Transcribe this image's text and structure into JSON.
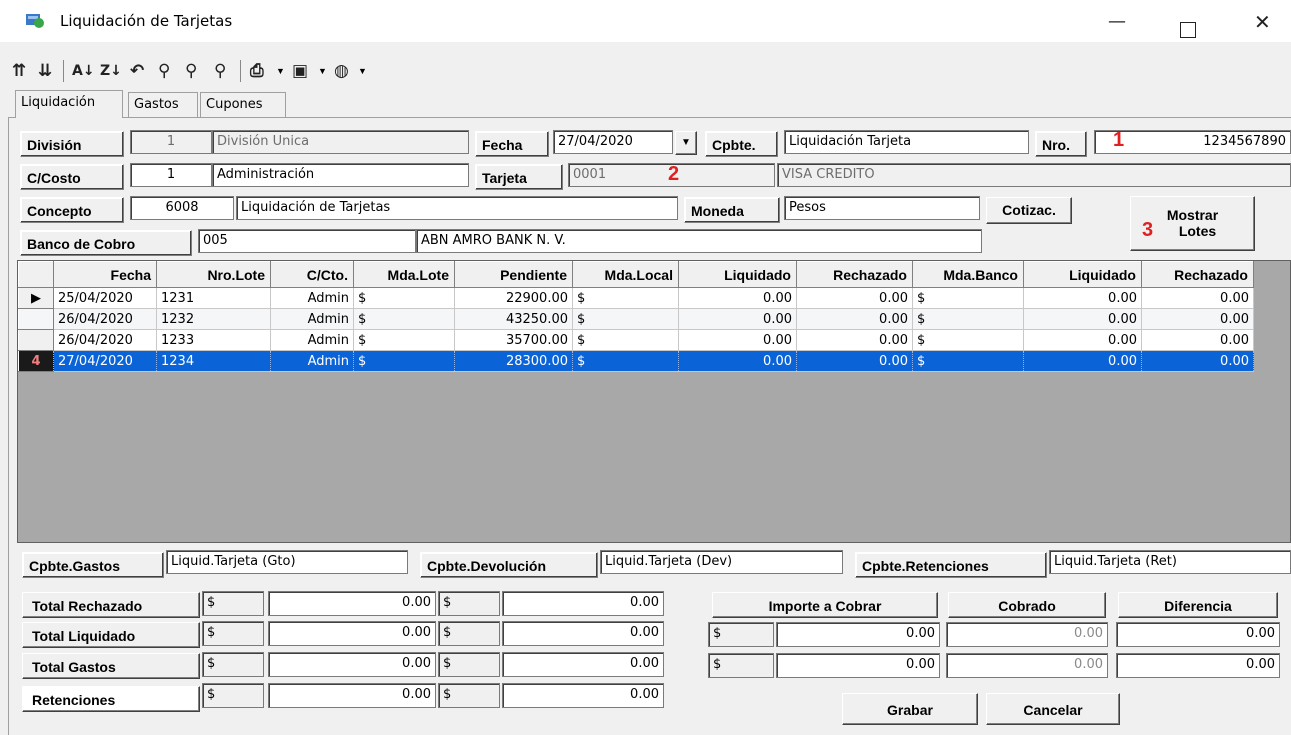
{
  "window": {
    "title": "Liquidación de Tarjetas",
    "minimize": "—",
    "close": "✕"
  },
  "toolbar": {
    "icons": [
      "indent-up-icon",
      "indent-down-icon",
      "sort-asc-icon",
      "sort-desc-icon",
      "undo-icon",
      "search-icon",
      "search-next-icon",
      "search-all-icon",
      "print-icon",
      "export-icon",
      "web-icon"
    ]
  },
  "tabs": [
    {
      "label": "Liquidación"
    },
    {
      "label": "Gastos"
    },
    {
      "label": "Cupones"
    }
  ],
  "form": {
    "division_label": "División",
    "division_code": "1",
    "division_name": "División Unica",
    "fecha_label": "Fecha",
    "fecha_value": "27/04/2020",
    "cpbte_label": "Cpbte.",
    "cpbte_value": "Liquidación Tarjeta",
    "nro_label": "Nro.",
    "nro_value": "1234567890",
    "costo_label": "C/Costo",
    "costo_code": "1",
    "costo_name": "Administración",
    "tarjeta_label": "Tarjeta",
    "tarjeta_code": "0001",
    "tarjeta_name": "VISA CREDITO",
    "concepto_label": "Concepto",
    "concepto_code": "6008",
    "concepto_name": "Liquidación de Tarjetas",
    "moneda_label": "Moneda",
    "moneda_value": "Pesos",
    "cotizac_label": "Cotizac.",
    "mostrar_label_1": "Mostrar",
    "mostrar_label_2": "Lotes",
    "banco_label": "Banco de Cobro",
    "banco_code": "005",
    "banco_name": "ABN AMRO BANK N. V."
  },
  "markers": {
    "m1": "1",
    "m2": "2",
    "m3": "3",
    "m4": "4"
  },
  "grid": {
    "headers": [
      "Fecha",
      "Nro.Lote",
      "C/Cto.",
      "Mda.Lote",
      "Pendiente",
      "Mda.Local",
      "Liquidado",
      "Rechazado",
      "Mda.Banco",
      "Liquidado",
      "Rechazado"
    ],
    "rows": [
      [
        "25/04/2020",
        "1231",
        "Admin",
        "$",
        "22900.00",
        "$",
        "0.00",
        "0.00",
        "$",
        "0.00",
        "0.00"
      ],
      [
        "26/04/2020",
        "1232",
        "Admin",
        "$",
        "43250.00",
        "$",
        "0.00",
        "0.00",
        "$",
        "0.00",
        "0.00"
      ],
      [
        "26/04/2020",
        "1233",
        "Admin",
        "$",
        "35700.00",
        "$",
        "0.00",
        "0.00",
        "$",
        "0.00",
        "0.00"
      ],
      [
        "27/04/2020",
        "1234",
        "Admin",
        "$",
        "28300.00",
        "$",
        "0.00",
        "0.00",
        "$",
        "0.00",
        "0.00"
      ]
    ],
    "current_row_glyph": "▶"
  },
  "cpbtes": {
    "gastos_label": "Cpbte.Gastos",
    "gastos_value": "Liquid.Tarjeta (Gto)",
    "devolucion_label": "Cpbte.Devolución",
    "devolucion_value": "Liquid.Tarjeta (Dev)",
    "retenciones_label": "Cpbte.Retenciones",
    "retenciones_value": "Liquid.Tarjeta (Ret)"
  },
  "totals": [
    {
      "label": "Total Rechazado",
      "cur1": "$",
      "amt1": "0.00",
      "cur2": "$",
      "amt2": "0.00"
    },
    {
      "label": "Total Liquidado",
      "cur1": "$",
      "amt1": "0.00",
      "cur2": "$",
      "amt2": "0.00"
    },
    {
      "label": "Total Gastos",
      "cur1": "$",
      "amt1": "0.00",
      "cur2": "$",
      "amt2": "0.00"
    },
    {
      "label": "Retenciones",
      "cur1": "$",
      "amt1": "0.00",
      "cur2": "$",
      "amt2": "0.00"
    }
  ],
  "cobro": {
    "importe_label": "Importe a Cobrar",
    "cobrado_label": "Cobrado",
    "diferencia_label": "Diferencia",
    "row1": {
      "cur": "$",
      "importe": "0.00",
      "cobrado": "0.00",
      "diferencia": "0.00"
    },
    "row2": {
      "cur": "$",
      "importe": "0.00",
      "cobrado": "0.00",
      "diferencia": "0.00"
    }
  },
  "actions": {
    "grabar": "Grabar",
    "cancelar": "Cancelar"
  }
}
